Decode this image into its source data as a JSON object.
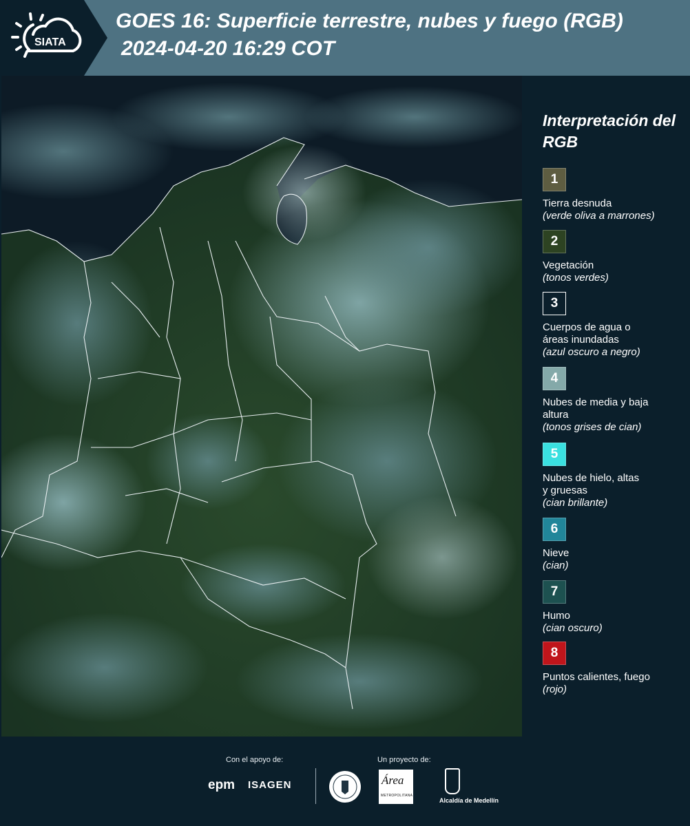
{
  "header": {
    "title_line1": "GOES 16: Superficie terrestre, nubes y fuego (RGB)",
    "title_line2": "2024-04-20 16:29 COT",
    "logo_text": "SIATA",
    "banner_color": "#4e7282"
  },
  "legend": {
    "title": "Interpretación del RGB",
    "items": [
      {
        "number": "1",
        "color": "#5e5d41",
        "label": "Tierra desnuda",
        "note": "(verde oliva a marrones)"
      },
      {
        "number": "2",
        "color": "#2d4322",
        "label": "Vegetación",
        "note": "(tonos verdes)"
      },
      {
        "number": "3",
        "color": "#0b1f2b",
        "label": "Cuerpos de agua o áreas inundadas",
        "note": "(azul oscuro a negro)"
      },
      {
        "number": "4",
        "color": "#84a9a9",
        "label": "Nubes de media y baja altura",
        "note": "(tonos grises de cian)"
      },
      {
        "number": "5",
        "color": "#3ae0e0",
        "label": "Nubes de hielo, altas y gruesas",
        "note": "(cian brillante)"
      },
      {
        "number": "6",
        "color": "#21869a",
        "label": "Nieve",
        "note": "(cian)"
      },
      {
        "number": "7",
        "color": "#1d5150",
        "label": "Humo",
        "note": "(cian oscuro)"
      },
      {
        "number": "8",
        "color": "#c0151b",
        "label": "Puntos calientes, fuego",
        "note": "(rojo)"
      }
    ]
  },
  "footer": {
    "support_label": "Con el apoyo de:",
    "project_label": "Un proyecto de:",
    "epm": "epm",
    "isagen": "ISAGEN",
    "amva_text": "Área",
    "amva_sub": "METROPOLITANA",
    "medellin": "Alcaldía de Medellín"
  }
}
